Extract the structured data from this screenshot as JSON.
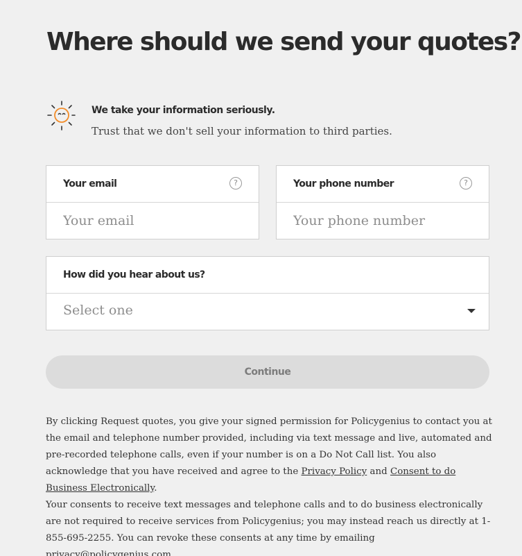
{
  "page": {
    "title": "Where should we send your quotes?"
  },
  "trust": {
    "icon": "sun-lock-icon",
    "heading": "We take your information seriously.",
    "subtext": "Trust that we don't sell your information to third parties.",
    "accent_color": "#f28c28"
  },
  "form": {
    "email": {
      "label": "Your email",
      "placeholder": "Your email",
      "value": "",
      "help_icon": "?"
    },
    "phone": {
      "label": "Your phone number",
      "placeholder": "Your phone number",
      "value": "",
      "help_icon": "?"
    },
    "referral": {
      "label": "How did you hear about us?",
      "selected": "Select one"
    },
    "continue_label": "Continue"
  },
  "legal": {
    "p1_text": "By clicking Request quotes, you give your signed permission for Policygenius to contact you at the email and telephone number provided, including via text message and live, automated and pre-recorded telephone calls, even if your number is on a Do Not Call list. You also acknowledge that you have received and agree to the",
    "privacy_link": "Privacy Policy",
    "and": "and",
    "consent_link": "Consent to do Business Electronically",
    "period": ".",
    "p2_text": "Your consents to receive text messages and telephone calls and to do business electronically are not required to receive services from Policygenius; you may instead reach us directly at 1-855-695-2255. You can revoke these consents at any time by emailing privacy@policygenius.com."
  },
  "colors": {
    "background": "#f0f0f0",
    "button_disabled_bg": "#dcdcdc",
    "button_disabled_text": "#7c7c7c",
    "border": "#cfcfcf"
  }
}
